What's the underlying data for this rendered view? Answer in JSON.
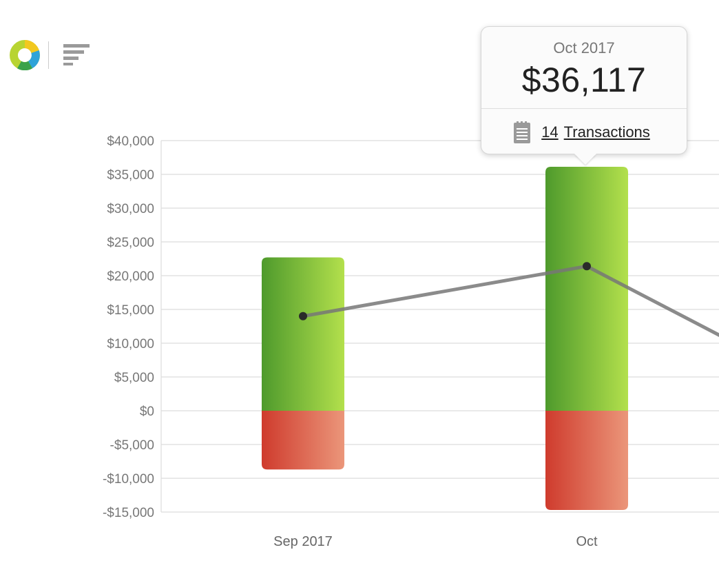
{
  "chart_data": {
    "type": "bar",
    "categories": [
      "Sep 2017",
      "Oct"
    ],
    "series": [
      {
        "values": [
          22700,
          36117
        ],
        "color": "#8cc63f"
      },
      {
        "values": [
          -8700,
          -14700
        ],
        "color": "#d84a3a"
      },
      {
        "type": "line",
        "values": [
          14000,
          21400
        ],
        "color": "#777777"
      }
    ],
    "y_ticks": [
      "$40,000",
      "$35,000",
      "$30,000",
      "$25,000",
      "$20,000",
      "$15,000",
      "$10,000",
      "$5,000",
      "$0",
      "-$5,000",
      "-$10,000",
      "-$15,000"
    ],
    "ylim": [
      -15000,
      40000
    ],
    "grid": true,
    "line_continues_right_to": 11000
  },
  "tooltip": {
    "month": "Oct 2017",
    "amount": "$36,117",
    "transactions_count": "14",
    "transactions_label": "Transactions"
  },
  "toolbar": {
    "chart_type_icon": "donut-chart-icon",
    "sort_icon": "horizontal-bars-icon"
  }
}
